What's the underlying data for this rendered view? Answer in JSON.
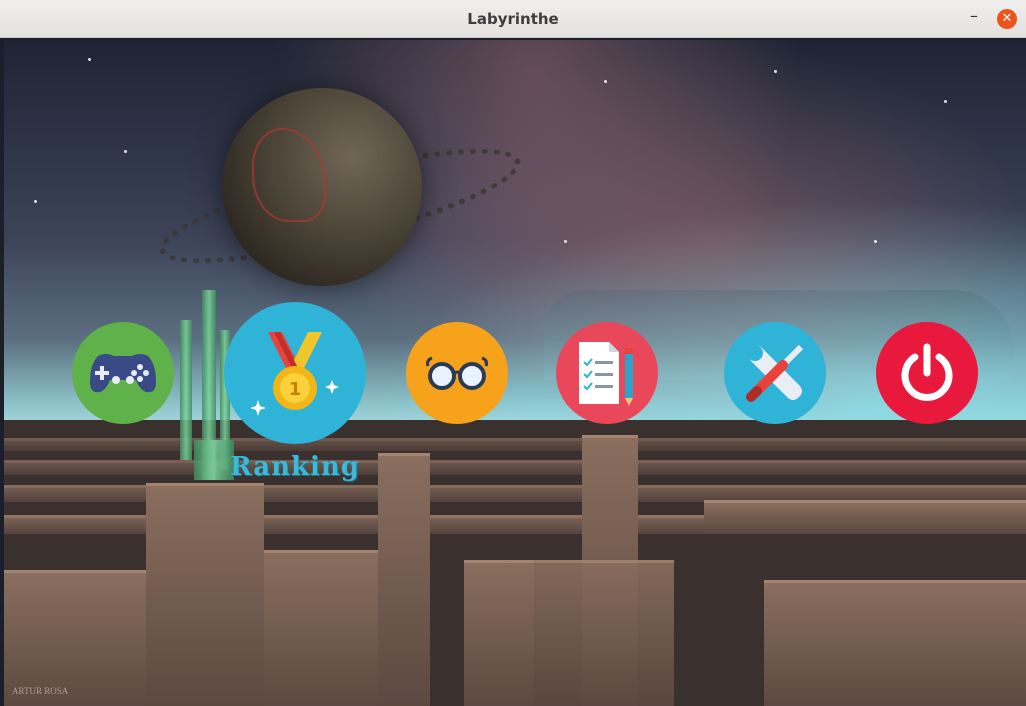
{
  "window": {
    "title": "Labyrinthe",
    "minimize_glyph": "–",
    "close_glyph": "✕"
  },
  "menu": {
    "items": [
      {
        "id": "play",
        "icon": "gamepad-icon",
        "color": "#5fb24a",
        "label": ""
      },
      {
        "id": "ranking",
        "icon": "medal-icon",
        "color": "#2fb3d6",
        "label": "Ranking",
        "hovered": true
      },
      {
        "id": "view",
        "icon": "glasses-icon",
        "color": "#f7a21b",
        "label": ""
      },
      {
        "id": "rules",
        "icon": "checklist-icon",
        "color": "#e9485a",
        "label": ""
      },
      {
        "id": "settings",
        "icon": "tools-icon",
        "color": "#2fb3d6",
        "label": ""
      },
      {
        "id": "quit",
        "icon": "power-icon",
        "color": "#e8193c",
        "label": ""
      }
    ]
  },
  "background": {
    "credit": "ARTUR ROSA"
  }
}
